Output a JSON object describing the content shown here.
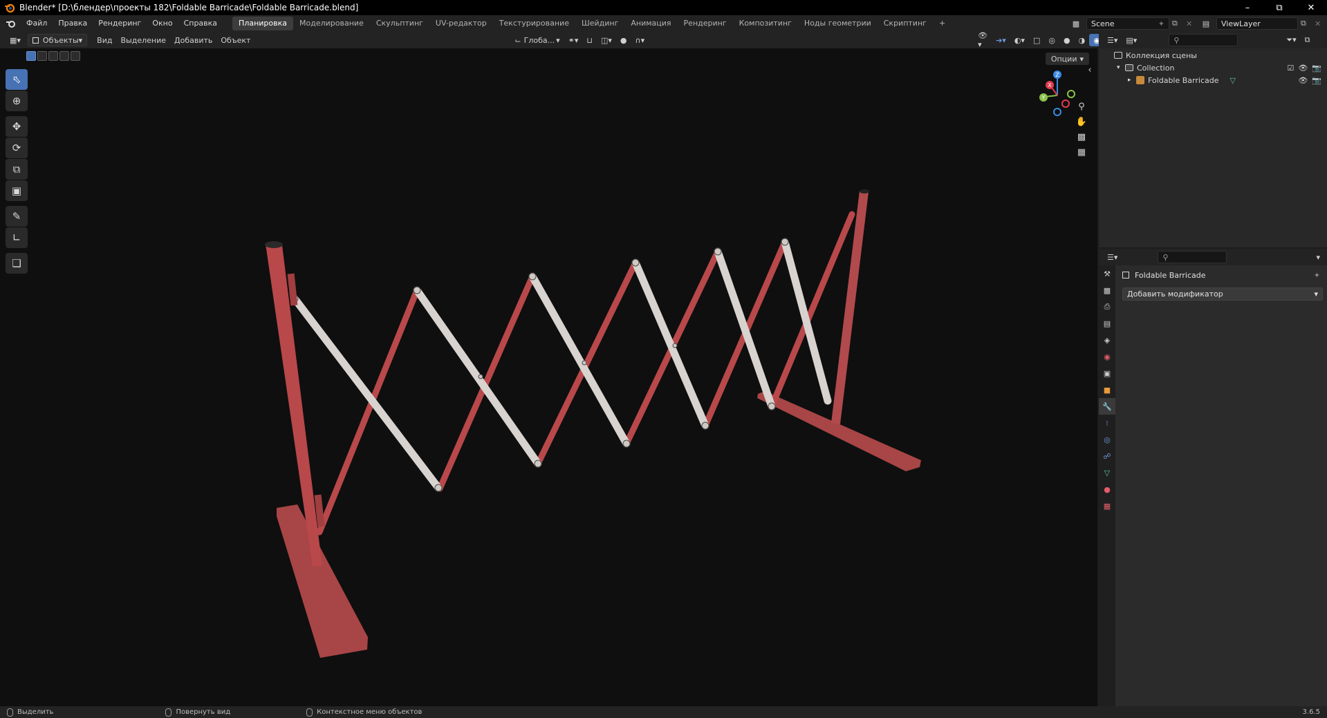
{
  "window": {
    "title": "Blender* [D:\\блендер\\проекты 182\\Foldable Barricade\\Foldable Barricade.blend]",
    "minimize_label": "–",
    "maximize_label": "⧉",
    "close_label": "✕"
  },
  "menu": [
    "Файл",
    "Правка",
    "Рендеринг",
    "Окно",
    "Справка"
  ],
  "workspaces": [
    "Планировка",
    "Моделирование",
    "Скульптинг",
    "UV-редактор",
    "Текстурирование",
    "Шейдинг",
    "Анимация",
    "Рендеринг",
    "Композитинг",
    "Ноды геометрии",
    "Скриптинг"
  ],
  "workspace_add": "+",
  "scene_name": "Scene",
  "view_layer": "ViewLayer",
  "viewport_header": {
    "mode": "Объекты",
    "menus": [
      "Вид",
      "Выделение",
      "Добавить",
      "Объект"
    ],
    "transform_orientation": "Глоба...",
    "options": "Опции"
  },
  "outliner": {
    "scene_collection": "Коллекция сцены",
    "collection": "Collection",
    "object": "Foldable Barricade"
  },
  "properties": {
    "object_name": "Foldable Barricade",
    "add_modifier": "Добавить модификатор"
  },
  "statusbar": {
    "select": "Выделить",
    "rotate_view": "Повернуть вид",
    "context_menu": "Контекстное меню объектов",
    "version": "3.6.5"
  },
  "gizmo_axes": {
    "x": "X",
    "y": "Y",
    "z": "Z"
  },
  "colors": {
    "accent": "#4772b3",
    "barricade_red": "#b8484a",
    "barricade_white": "#d8d3cf",
    "axis_x": "#e33b4e",
    "axis_y": "#8bc34a",
    "axis_z": "#3b8be3"
  }
}
